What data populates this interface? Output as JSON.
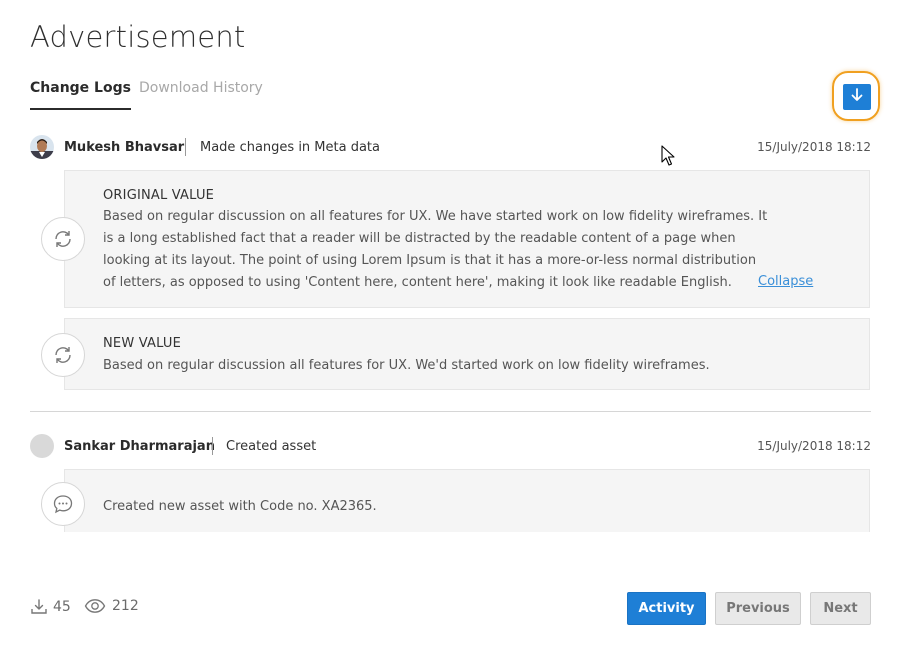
{
  "page": {
    "title": "Advertisement"
  },
  "tabs": [
    {
      "label": "Change Logs",
      "active": true
    },
    {
      "label": "Download History",
      "active": false
    }
  ],
  "toolbar": {
    "download_icon": "arrow-down-icon",
    "accent": "#1e7fd6",
    "highlight": "#f0a020"
  },
  "entries": [
    {
      "author": "Mukesh Bhavsar",
      "action": "Made changes in Meta data",
      "timestamp": "15/July/2018 18:12",
      "original": {
        "label": "ORIGINAL VALUE",
        "lines": [
          "Based on regular discussion on all features for UX. We have started work on low fidelity wireframes. It",
          "is a long established fact that a reader will be distracted by the readable content of a page when",
          "looking at its layout. The point of using Lorem Ipsum is that it has a more-or-less normal distribution",
          "of letters, as opposed to using 'Content here, content here', making it look like readable English."
        ],
        "collapse_label": "Collapse",
        "icon": "refresh-icon"
      },
      "new": {
        "label": "NEW VALUE",
        "text": "Based on regular discussion all features for UX. We'd started work on low fidelity wireframes.",
        "icon": "refresh-icon"
      }
    },
    {
      "author": "Sankar Dharmarajan",
      "action": "Created asset",
      "timestamp": "15/July/2018 18:12",
      "note": {
        "text": "Created new asset with Code no. XA2365.",
        "icon": "comment-icon"
      }
    }
  ],
  "footer": {
    "downloads": "45",
    "views": "212",
    "activity_label": "Activity",
    "previous_label": "Previous",
    "next_label": "Next"
  }
}
